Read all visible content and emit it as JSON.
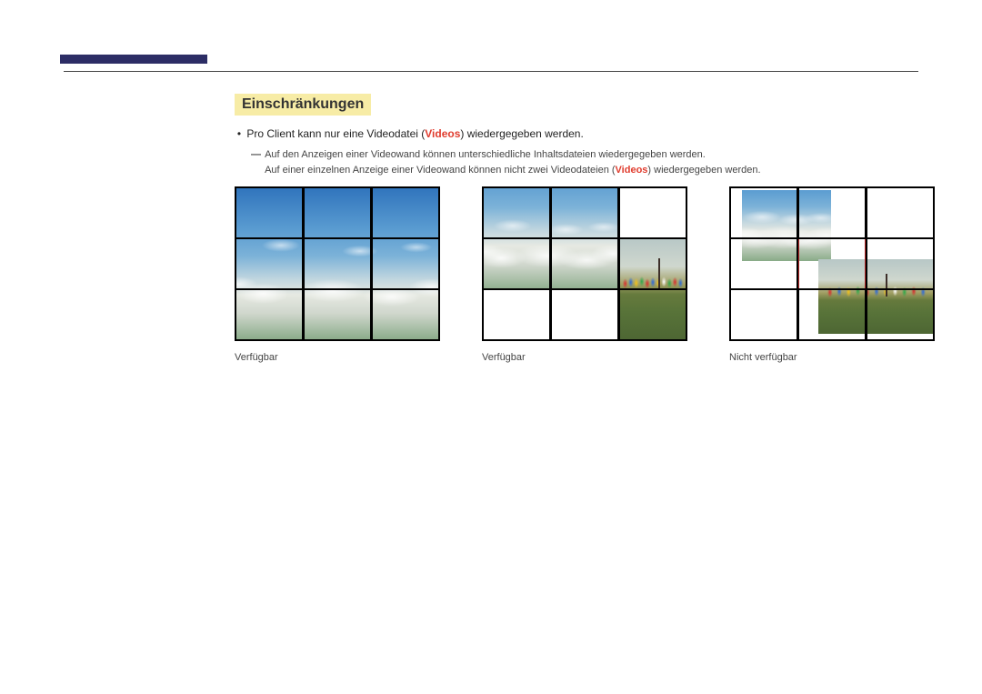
{
  "colors": {
    "accent": "#2c2d65",
    "highlight_bg": "#f7eca6",
    "keyword": "#e03c2e"
  },
  "heading": "Einschränkungen",
  "bullet": {
    "pre": "Pro Client kann nur eine Videodatei (",
    "kw": "Videos",
    "post": ") wiedergegeben werden."
  },
  "sub": {
    "line1": "Auf den Anzeigen einer Videowand können unterschiedliche Inhaltsdateien wiedergegeben werden.",
    "line2_pre": "Auf einer einzelnen Anzeige einer Videowand können nicht zwei Videodateien (",
    "line2_kw": "Videos",
    "line2_post": ") wiedergegeben werden."
  },
  "captions": {
    "c1": "Verfügbar",
    "c2": "Verfügbar",
    "c3": "Nicht verfügbar"
  }
}
